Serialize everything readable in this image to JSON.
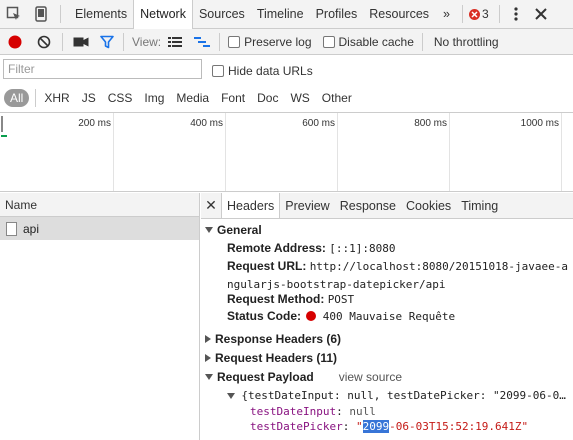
{
  "tabs": [
    "Elements",
    "Network",
    "Sources",
    "Timeline",
    "Profiles",
    "Resources"
  ],
  "overflow_label": "»",
  "error_count": "3",
  "toolbar": {
    "view_label": "View:",
    "preserve_log": "Preserve log",
    "disable_cache": "Disable cache",
    "throttling": "No throttling"
  },
  "filter": {
    "placeholder": "Filter",
    "hide_data_urls": "Hide data URLs"
  },
  "types": [
    "All",
    "XHR",
    "JS",
    "CSS",
    "Img",
    "Media",
    "Font",
    "Doc",
    "WS",
    "Other"
  ],
  "timeline_ticks": [
    "200 ms",
    "400 ms",
    "600 ms",
    "800 ms",
    "1000 ms"
  ],
  "requests_header": "Name",
  "requests": [
    "api"
  ],
  "detail_tabs": [
    "Headers",
    "Preview",
    "Response",
    "Cookies",
    "Timing"
  ],
  "general": {
    "title": "General",
    "remote_address_label": "Remote Address:",
    "remote_address": "[::1]:8080",
    "request_url_label": "Request URL:",
    "request_url_line1": "http://localhost:8080/20151018-javaee-a",
    "request_url_line2": "ngularjs-bootstrap-datepicker/api",
    "request_method_label": "Request Method:",
    "request_method": "POST",
    "status_code_label": "Status Code:",
    "status_code": "400 Mauvaise Requête"
  },
  "response_headers": "Response Headers (6)",
  "request_headers": "Request Headers (11)",
  "payload": {
    "title": "Request Payload",
    "view_source": "view source",
    "summary": "{testDateInput: null, testDatePicker: \"2099-06-0…",
    "field1_key": "testDateInput",
    "field1_value": "null",
    "field2_key": "testDatePicker",
    "field2_quote_open": "\"",
    "field2_selected": "2099",
    "field2_rest": "-06-03T15:52:19.641Z\""
  },
  "colors": {
    "record_red": "#d60000",
    "filter_blue": "#1a73e8",
    "error_red": "#d93025"
  }
}
